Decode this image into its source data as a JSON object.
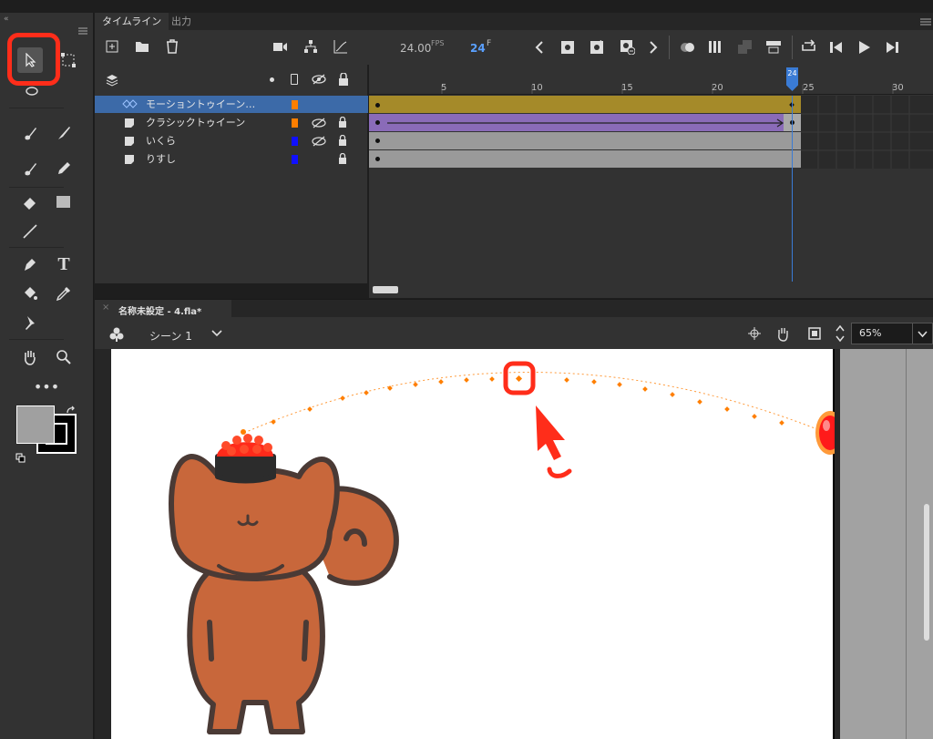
{
  "timeline": {
    "tab_timeline": "タイムライン",
    "tab_output": "出力",
    "fps": "24.00",
    "fps_unit": "FPS",
    "frame": "24",
    "frame_unit": "F",
    "ruler": [
      "5",
      "10",
      "15",
      "20",
      "25",
      "30"
    ],
    "playhead_frame": "24",
    "layers": [
      {
        "name": "モーショントゥイーン…",
        "color": "#ff7f00",
        "selected": true
      },
      {
        "name": "クラシックトゥイーン",
        "color": "#ff7f00"
      },
      {
        "name": "いくら",
        "color": "#1010ff"
      },
      {
        "name": "りすし",
        "color": "#1010ff"
      }
    ]
  },
  "document": {
    "tab": "名称未設定 - 4.fla*",
    "scene": "シーン 1",
    "zoom": "65%"
  },
  "colors": {
    "panel": "#323232",
    "dark": "#262626",
    "accent": "#3a7bd5",
    "motion_tween": "#a58a29",
    "classic_tween": "#8a6bb8",
    "highlight": "#ff2d1a",
    "squirrel": "#c8673b"
  }
}
